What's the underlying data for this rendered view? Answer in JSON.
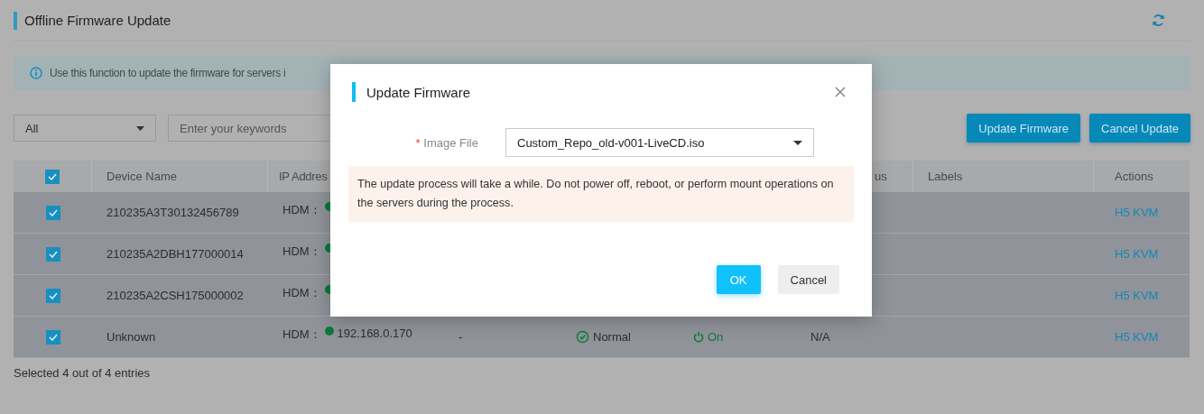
{
  "page": {
    "title": "Offline Firmware Update",
    "info": "Use this function to update the firmware for servers i",
    "filter": {
      "value": "All"
    },
    "search": {
      "placeholder": "Enter your keywords"
    },
    "buttons": [
      "Update Firmware",
      "Cancel Update"
    ]
  },
  "table": {
    "select_all": {
      "checked": true
    },
    "columns": [
      {
        "label": "Device Name"
      },
      {
        "label": "IP Addres"
      },
      {},
      {},
      {},
      {
        "label": "us"
      },
      {
        "label": "Labels"
      },
      {
        "label": "Actions"
      }
    ],
    "rows": [
      {
        "checked": true,
        "device_name": "210235A3T30132456789",
        "ip_label": "HDM：",
        "action": "H5 KVM"
      },
      {
        "checked": true,
        "device_name": "210235A2DBH177000014",
        "ip_label": "HDM：",
        "action": "H5 KVM"
      },
      {
        "checked": true,
        "device_name": "210235A2CSH175000002",
        "ip_label": "HDM：",
        "action": "H5 KVM"
      },
      {
        "checked": true,
        "device_name": "Unknown",
        "ip_label": "HDM：",
        "ip": "192.168.0.170",
        "column_4": "-",
        "health": "Normal",
        "power": "On",
        "column_7": "N/A",
        "action": "H5 KVM"
      }
    ]
  },
  "footer": "Selected 4 out of 4 entries",
  "dialog": {
    "title": "Update Firmware",
    "field": {
      "label": "Image File",
      "required_mark": "*",
      "value": "Custom_Repo_old-v001-LiveCD.iso"
    },
    "warning": "The update process will take a while. Do not power off, reboot, or perform mount operations on the servers during the process.",
    "buttons": [
      {
        "label": "OK",
        "kind": "primary"
      },
      {
        "label": "Cancel",
        "kind": "secondary"
      }
    ]
  }
}
